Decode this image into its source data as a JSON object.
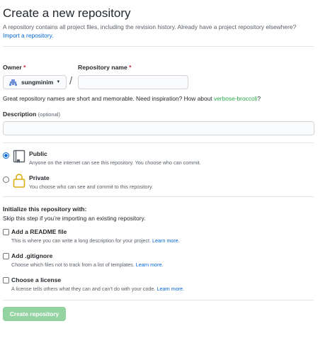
{
  "header": {
    "title": "Create a new repository",
    "description": "A repository contains all project files, including the revision history. Already have a project repository elsewhere?",
    "import_link": "Import a repository."
  },
  "owner": {
    "label": "Owner",
    "required_mark": "*",
    "value": "sungminim"
  },
  "separator": "/",
  "repo_name": {
    "label": "Repository name",
    "required_mark": "*",
    "value": ""
  },
  "name_hint": {
    "prefix": "Great repository names are short and memorable. Need inspiration? How about ",
    "suggestion": "verbose-broccoli",
    "suffix": "?"
  },
  "description": {
    "label": "Description",
    "optional": "(optional)",
    "value": ""
  },
  "visibility": {
    "public": {
      "title": "Public",
      "desc": "Anyone on the internet can see this repository. You choose who can commit.",
      "checked": true
    },
    "private": {
      "title": "Private",
      "desc": "You choose who can see and commit to this repository.",
      "checked": false
    }
  },
  "init": {
    "title": "Initialize this repository with:",
    "subtitle": "Skip this step if you’re importing an existing repository.",
    "readme": {
      "title": "Add a README file",
      "desc": "This is where you can write a long description for your project.",
      "link": "Learn more."
    },
    "gitignore": {
      "title": "Add .gitignore",
      "desc": "Choose which files not to track from a list of templates.",
      "link": "Learn more."
    },
    "license": {
      "title": "Choose a license",
      "desc": "A license tells others what they can and can’t do with your code.",
      "link": "Learn more."
    }
  },
  "submit": {
    "label": "Create repository"
  }
}
